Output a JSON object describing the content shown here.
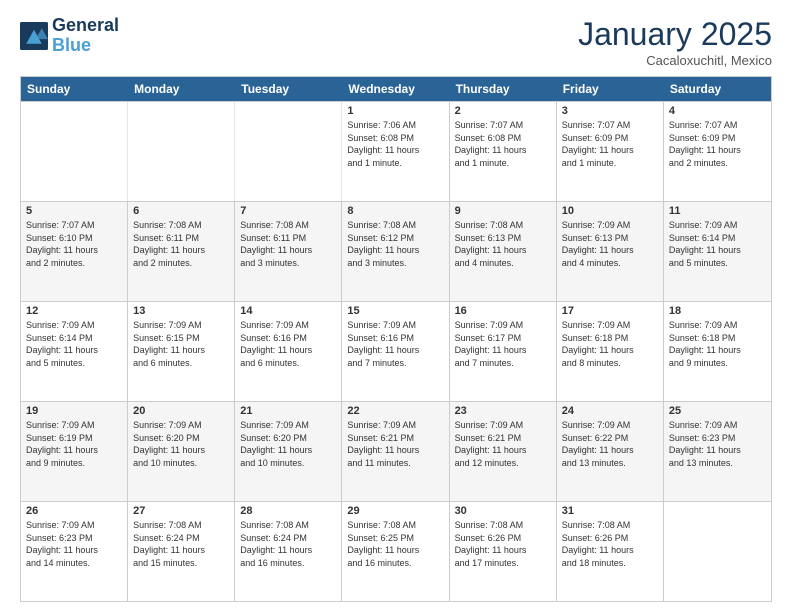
{
  "logo": {
    "line1": "General",
    "line2": "Blue"
  },
  "title": "January 2025",
  "location": "Cacaloxuchitl, Mexico",
  "dayHeaders": [
    "Sunday",
    "Monday",
    "Tuesday",
    "Wednesday",
    "Thursday",
    "Friday",
    "Saturday"
  ],
  "weeks": [
    [
      {
        "day": "",
        "empty": true,
        "info": ""
      },
      {
        "day": "",
        "empty": true,
        "info": ""
      },
      {
        "day": "",
        "empty": true,
        "info": ""
      },
      {
        "day": "1",
        "empty": false,
        "info": "Sunrise: 7:06 AM\nSunset: 6:08 PM\nDaylight: 11 hours\nand 1 minute."
      },
      {
        "day": "2",
        "empty": false,
        "info": "Sunrise: 7:07 AM\nSunset: 6:08 PM\nDaylight: 11 hours\nand 1 minute."
      },
      {
        "day": "3",
        "empty": false,
        "info": "Sunrise: 7:07 AM\nSunset: 6:09 PM\nDaylight: 11 hours\nand 1 minute."
      },
      {
        "day": "4",
        "empty": false,
        "info": "Sunrise: 7:07 AM\nSunset: 6:09 PM\nDaylight: 11 hours\nand 2 minutes."
      }
    ],
    [
      {
        "day": "5",
        "empty": false,
        "info": "Sunrise: 7:07 AM\nSunset: 6:10 PM\nDaylight: 11 hours\nand 2 minutes."
      },
      {
        "day": "6",
        "empty": false,
        "info": "Sunrise: 7:08 AM\nSunset: 6:11 PM\nDaylight: 11 hours\nand 2 minutes."
      },
      {
        "day": "7",
        "empty": false,
        "info": "Sunrise: 7:08 AM\nSunset: 6:11 PM\nDaylight: 11 hours\nand 3 minutes."
      },
      {
        "day": "8",
        "empty": false,
        "info": "Sunrise: 7:08 AM\nSunset: 6:12 PM\nDaylight: 11 hours\nand 3 minutes."
      },
      {
        "day": "9",
        "empty": false,
        "info": "Sunrise: 7:08 AM\nSunset: 6:13 PM\nDaylight: 11 hours\nand 4 minutes."
      },
      {
        "day": "10",
        "empty": false,
        "info": "Sunrise: 7:09 AM\nSunset: 6:13 PM\nDaylight: 11 hours\nand 4 minutes."
      },
      {
        "day": "11",
        "empty": false,
        "info": "Sunrise: 7:09 AM\nSunset: 6:14 PM\nDaylight: 11 hours\nand 5 minutes."
      }
    ],
    [
      {
        "day": "12",
        "empty": false,
        "info": "Sunrise: 7:09 AM\nSunset: 6:14 PM\nDaylight: 11 hours\nand 5 minutes."
      },
      {
        "day": "13",
        "empty": false,
        "info": "Sunrise: 7:09 AM\nSunset: 6:15 PM\nDaylight: 11 hours\nand 6 minutes."
      },
      {
        "day": "14",
        "empty": false,
        "info": "Sunrise: 7:09 AM\nSunset: 6:16 PM\nDaylight: 11 hours\nand 6 minutes."
      },
      {
        "day": "15",
        "empty": false,
        "info": "Sunrise: 7:09 AM\nSunset: 6:16 PM\nDaylight: 11 hours\nand 7 minutes."
      },
      {
        "day": "16",
        "empty": false,
        "info": "Sunrise: 7:09 AM\nSunset: 6:17 PM\nDaylight: 11 hours\nand 7 minutes."
      },
      {
        "day": "17",
        "empty": false,
        "info": "Sunrise: 7:09 AM\nSunset: 6:18 PM\nDaylight: 11 hours\nand 8 minutes."
      },
      {
        "day": "18",
        "empty": false,
        "info": "Sunrise: 7:09 AM\nSunset: 6:18 PM\nDaylight: 11 hours\nand 9 minutes."
      }
    ],
    [
      {
        "day": "19",
        "empty": false,
        "info": "Sunrise: 7:09 AM\nSunset: 6:19 PM\nDaylight: 11 hours\nand 9 minutes."
      },
      {
        "day": "20",
        "empty": false,
        "info": "Sunrise: 7:09 AM\nSunset: 6:20 PM\nDaylight: 11 hours\nand 10 minutes."
      },
      {
        "day": "21",
        "empty": false,
        "info": "Sunrise: 7:09 AM\nSunset: 6:20 PM\nDaylight: 11 hours\nand 10 minutes."
      },
      {
        "day": "22",
        "empty": false,
        "info": "Sunrise: 7:09 AM\nSunset: 6:21 PM\nDaylight: 11 hours\nand 11 minutes."
      },
      {
        "day": "23",
        "empty": false,
        "info": "Sunrise: 7:09 AM\nSunset: 6:21 PM\nDaylight: 11 hours\nand 12 minutes."
      },
      {
        "day": "24",
        "empty": false,
        "info": "Sunrise: 7:09 AM\nSunset: 6:22 PM\nDaylight: 11 hours\nand 13 minutes."
      },
      {
        "day": "25",
        "empty": false,
        "info": "Sunrise: 7:09 AM\nSunset: 6:23 PM\nDaylight: 11 hours\nand 13 minutes."
      }
    ],
    [
      {
        "day": "26",
        "empty": false,
        "info": "Sunrise: 7:09 AM\nSunset: 6:23 PM\nDaylight: 11 hours\nand 14 minutes."
      },
      {
        "day": "27",
        "empty": false,
        "info": "Sunrise: 7:08 AM\nSunset: 6:24 PM\nDaylight: 11 hours\nand 15 minutes."
      },
      {
        "day": "28",
        "empty": false,
        "info": "Sunrise: 7:08 AM\nSunset: 6:24 PM\nDaylight: 11 hours\nand 16 minutes."
      },
      {
        "day": "29",
        "empty": false,
        "info": "Sunrise: 7:08 AM\nSunset: 6:25 PM\nDaylight: 11 hours\nand 16 minutes."
      },
      {
        "day": "30",
        "empty": false,
        "info": "Sunrise: 7:08 AM\nSunset: 6:26 PM\nDaylight: 11 hours\nand 17 minutes."
      },
      {
        "day": "31",
        "empty": false,
        "info": "Sunrise: 7:08 AM\nSunset: 6:26 PM\nDaylight: 11 hours\nand 18 minutes."
      },
      {
        "day": "",
        "empty": true,
        "info": ""
      }
    ]
  ]
}
